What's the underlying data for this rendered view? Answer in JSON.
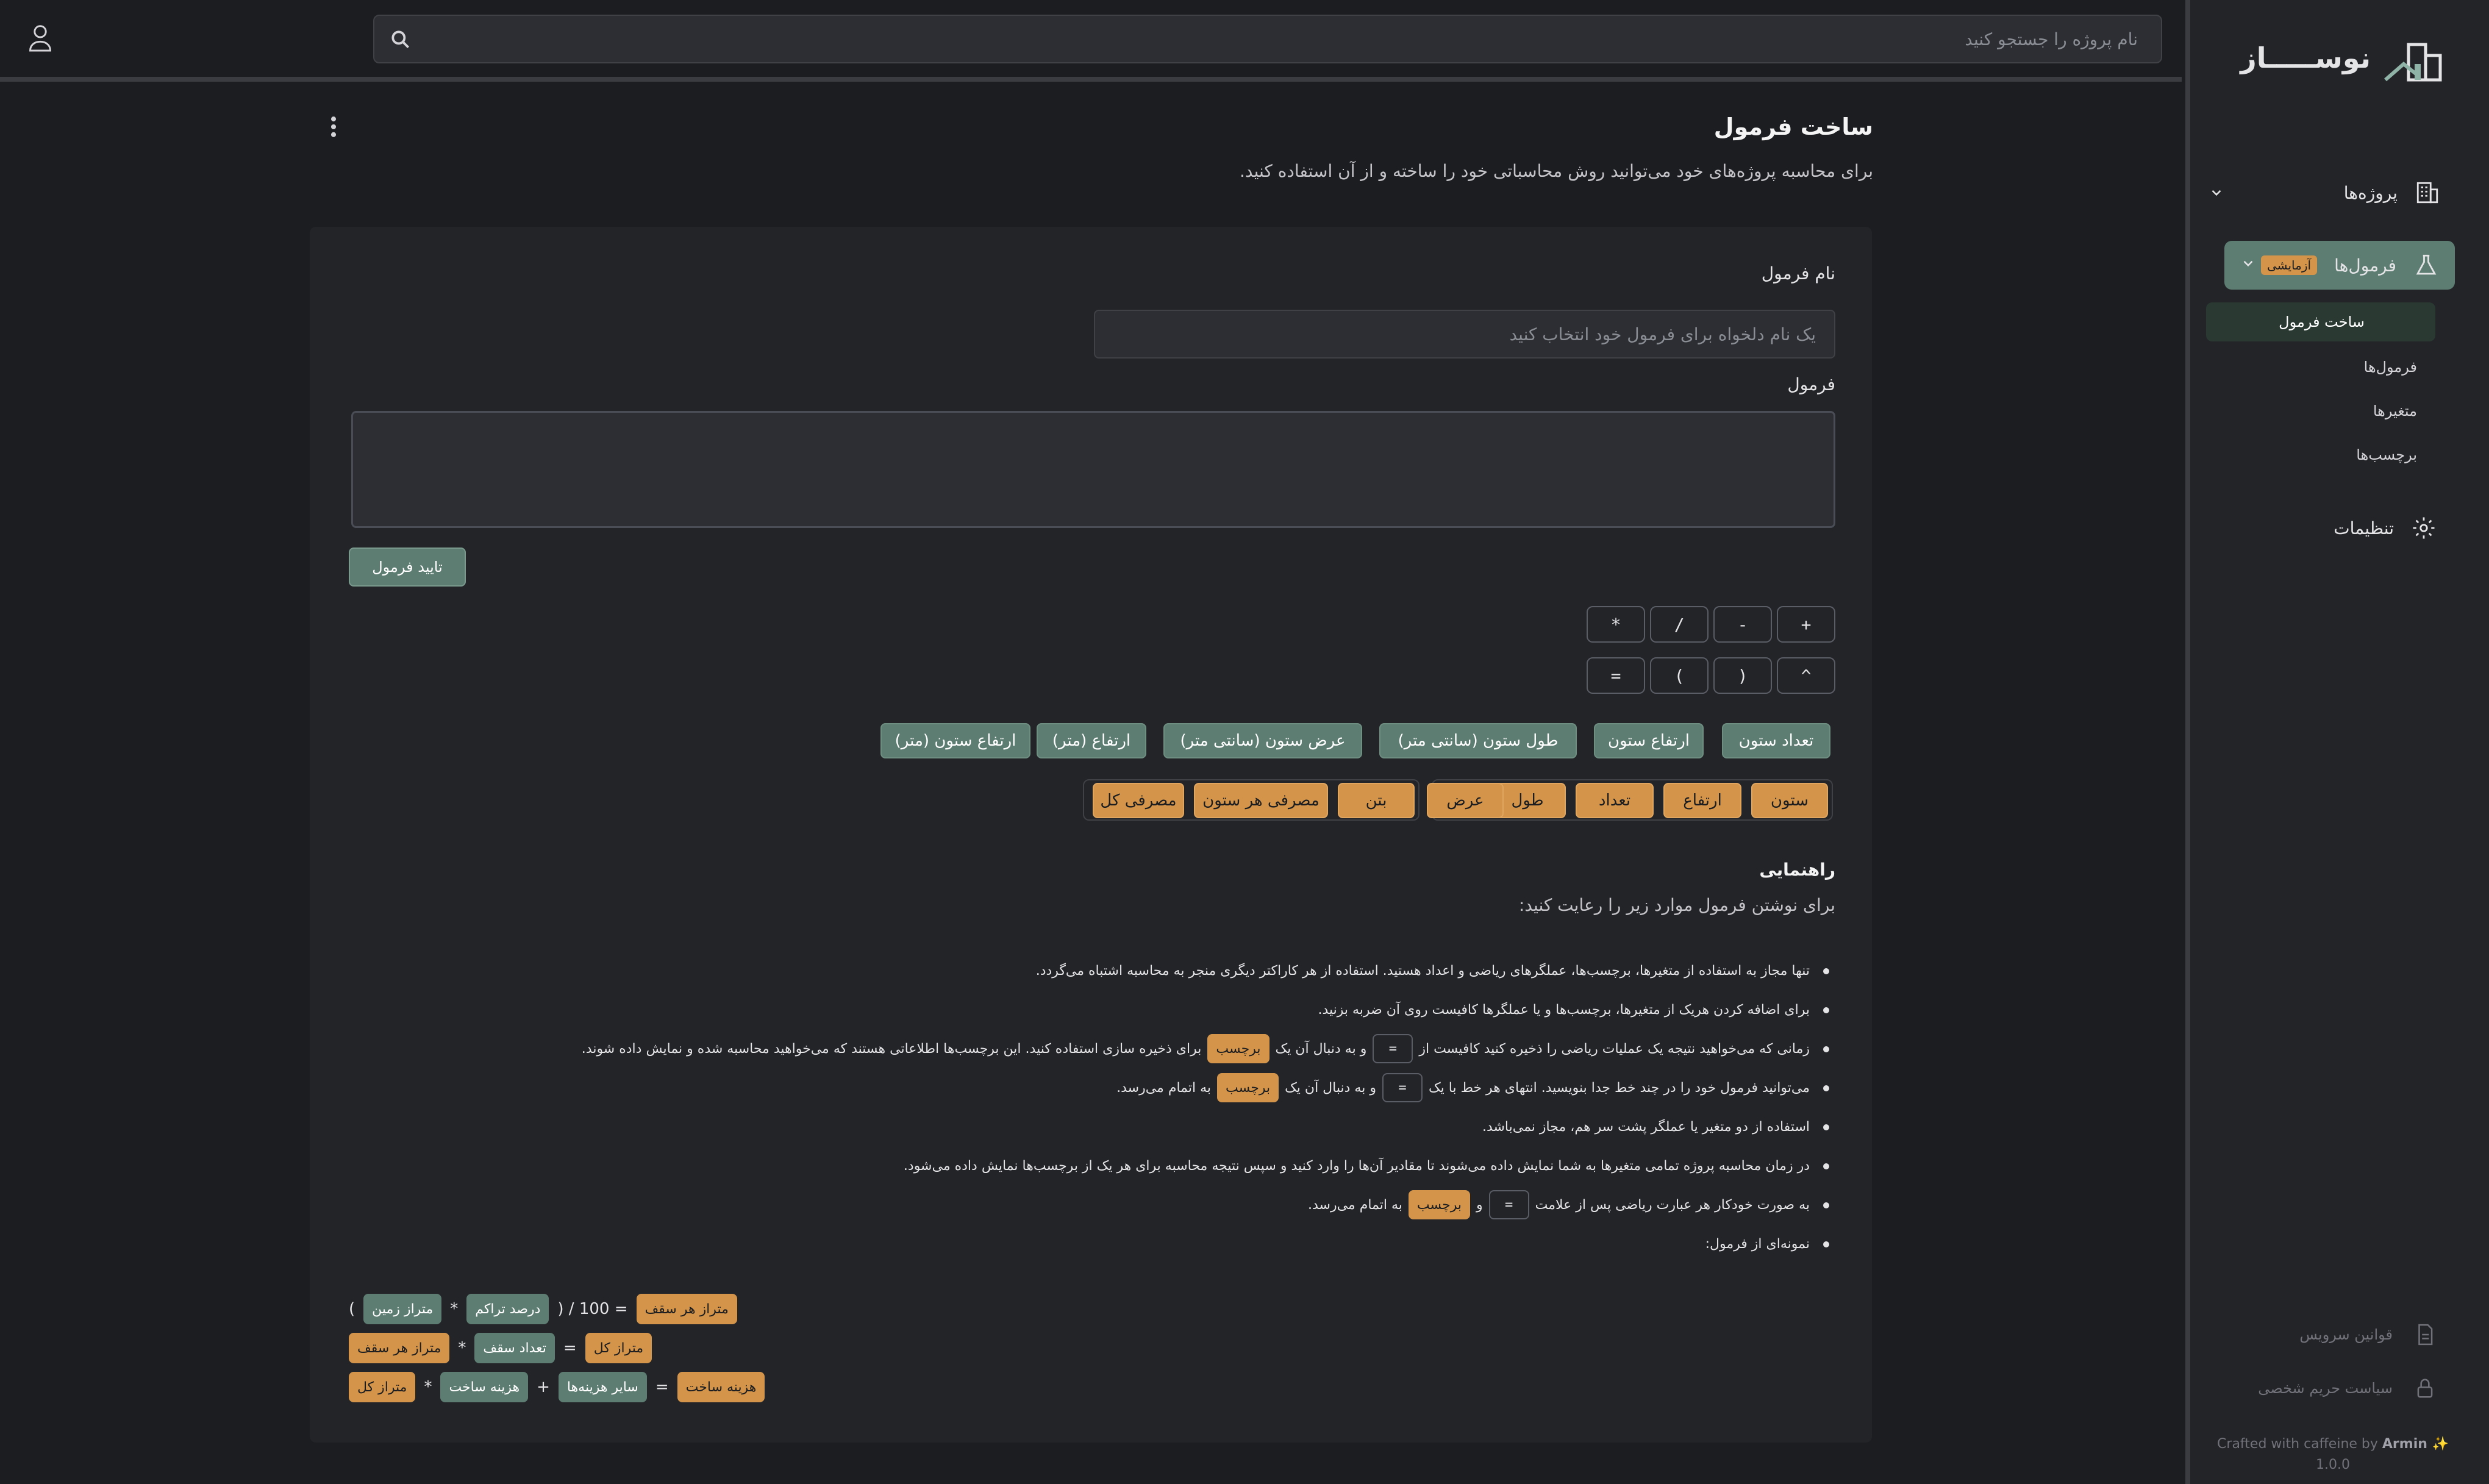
{
  "brand": {
    "name": "نوســـــاز"
  },
  "search": {
    "placeholder": "نام پروژه را جستجو کنید"
  },
  "sidebar": {
    "projects": "پروژه‌ها",
    "formulas": "فرمول‌ها",
    "formulas_badge": "آزمایشی",
    "sub_items": [
      "ساخت فرمول",
      "فرمول‌ها",
      "متغیرها",
      "برچسب‌ها"
    ],
    "settings": "تنظیمات",
    "terms": "قوانین سرویس",
    "privacy": "سیاست حریم شخصی",
    "credit_text": "Crafted with caffeine by",
    "credit_author": "Armin ✨",
    "version": "1.0.0"
  },
  "page": {
    "title": "ساخت فرمول",
    "description": "برای محاسبه پروژه‌های خود می‌توانید روش محاسباتی خود را ساخته و از آن استفاده کنید."
  },
  "form": {
    "name_label": "نام فرمول",
    "name_placeholder": "یک نام دلخواه برای فرمول خود انتخاب کنید",
    "formula_label": "فرمول",
    "formula_value": "",
    "confirm_label": "تایید فرمول"
  },
  "operators": [
    "+",
    "-",
    "/",
    "*",
    "^",
    "(",
    ")",
    "="
  ],
  "variables": [
    "تعداد ستون",
    "ارتفاع ستون",
    "طول ستون (سانتی متر)",
    "عرض ستون (سانتی متر)",
    "ارتفاع (متر)",
    "ارتفاع ستون (متر)"
  ],
  "labels_group1": [
    "ستون",
    "ارتفاع",
    "تعداد",
    "طول",
    "عرض"
  ],
  "labels_group2": [
    "بتن",
    "مصرفی هر ستون",
    "مصرفی کل"
  ],
  "guide": {
    "title": "راهنمایی",
    "intro": "برای نوشتن فرمول موارد زیر را رعایت کنید:",
    "r1": "تنها مجاز به استفاده از متغیرها، برچسب‌ها، عملگرهای ریاضی و اعداد هستید. استفاده از هر کاراکتر دیگری منجر به محاسبه اشتباه می‌گردد.",
    "r2": "برای اضافه کردن هریک از متغیرها، برچسب‌ها و یا عملگرها کافیست روی آن ضربه بزنید.",
    "r3a": "زمانی که می‌خواهید نتیجه یک عملیات ریاضی را ذخیره کنید کافیست از",
    "r3b": "و به دنبال آن یک",
    "r3c": "برای ذخیره سازی استفاده کنید. این برچسب‌ها اطلاعاتی هستند که می‌خواهید محاسبه شده و نمایش داده شوند.",
    "r4a": "می‌توانید فرمول خود را در چند خط جدا بنویسید. انتهای هر خط با یک",
    "r4b": "و به دنبال آن یک",
    "r4c": "به اتمام می‌رسد.",
    "r5": "استفاده از دو متغیر یا عملگر پشت سر هم، مجاز نمی‌باشد.",
    "r6": "در زمان محاسبه پروژه تمامی متغیرها به شما نمایش داده می‌شوند تا مقادیر آن‌ها را وارد کنید و سپس نتیجه محاسبه برای هر یک از برچسب‌ها نمایش داده می‌شود.",
    "r7a": "به صورت خودکار هر عبارت ریاضی پس از علامت",
    "r7b": "و",
    "r7c": "به اتمام می‌رسد.",
    "r8": "نمونه‌ای از فرمول:",
    "eq": "=",
    "lbl": "برچسب"
  },
  "examples": {
    "l1": {
      "open": "(",
      "a": "متراز زمین",
      "op1": "*",
      "b": "درصد تراکم",
      "close": ") / 100 =",
      "c": "متراز هر سقف"
    },
    "l2": {
      "a": "متراز هر سقف",
      "op1": "*",
      "b": "تعداد سقف",
      "eq": "=",
      "c": "متراز کل"
    },
    "l3": {
      "a": "متراز کل",
      "op1": "*",
      "b": "هزینه ساخت",
      "op2": "+",
      "c": "سایر هزینه‌ها",
      "eq": "=",
      "d": "هزینه ساخت"
    }
  },
  "colors": {
    "accent_green": "#5d7d72",
    "accent_orange": "#d4954a",
    "background": "#1c1d20"
  }
}
